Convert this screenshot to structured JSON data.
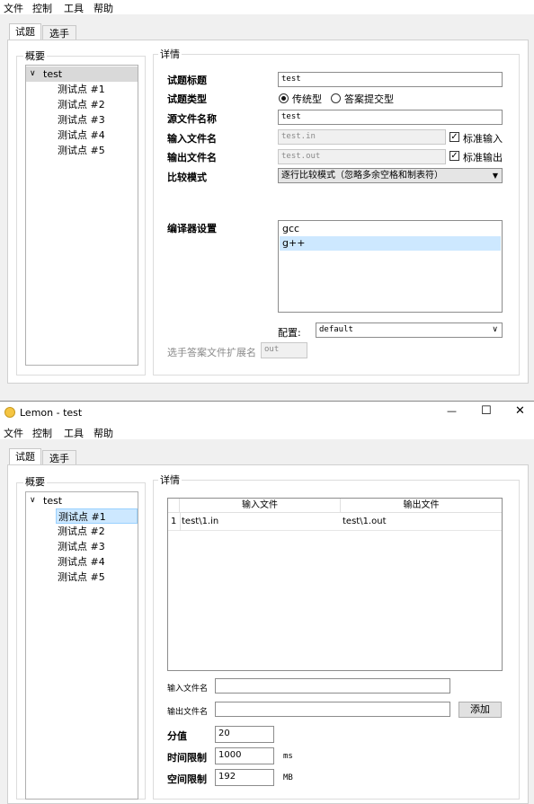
{
  "menu": [
    "文件",
    "控制",
    "工具",
    "帮助"
  ],
  "window_title": "Lemon - test",
  "window_controls": {
    "minimize": "—",
    "maximize": "☐",
    "close": "✕"
  },
  "tabs": [
    "试题",
    "选手"
  ],
  "tree": {
    "group_label": "概要",
    "root": "test",
    "expander": "∨",
    "children": [
      "测试点 #1",
      "测试点 #2",
      "测试点 #3",
      "测试点 #4",
      "测试点 #5"
    ]
  },
  "details_label": "详情",
  "top_form": {
    "title_label": "试题标题",
    "title_value": "test",
    "type_label": "试题类型",
    "type_options": [
      "传统型",
      "答案提交型"
    ],
    "type_selected": 0,
    "source_label": "源文件名称",
    "source_value": "test",
    "input_label": "输入文件名",
    "input_value": "test.in",
    "stdin_label": "标准输入",
    "output_label": "输出文件名",
    "output_value": "test.out",
    "stdout_label": "标准输出",
    "compare_label": "比较模式",
    "compare_value": "逐行比较模式（忽略多余空格和制表符）",
    "compiler_label": "编译器设置",
    "compilers": [
      "gcc",
      "g++"
    ],
    "config_label": "配置:",
    "config_value": "default",
    "ext_label": "选手答案文件扩展名",
    "ext_value": "out"
  },
  "bottom_form": {
    "table_headers": [
      "输入文件",
      "输出文件"
    ],
    "table_rows": [
      {
        "num": "1",
        "input": "test\\1.in",
        "output": "test\\1.out"
      }
    ],
    "input_file_label": "输入文件名",
    "output_file_label": "输出文件名",
    "add_button": "添加",
    "score_label": "分值",
    "score_value": "20",
    "time_label": "时间限制",
    "time_value": "1000",
    "time_unit": "ms",
    "memory_label": "空间限制",
    "memory_value": "192",
    "memory_unit": "MB"
  }
}
